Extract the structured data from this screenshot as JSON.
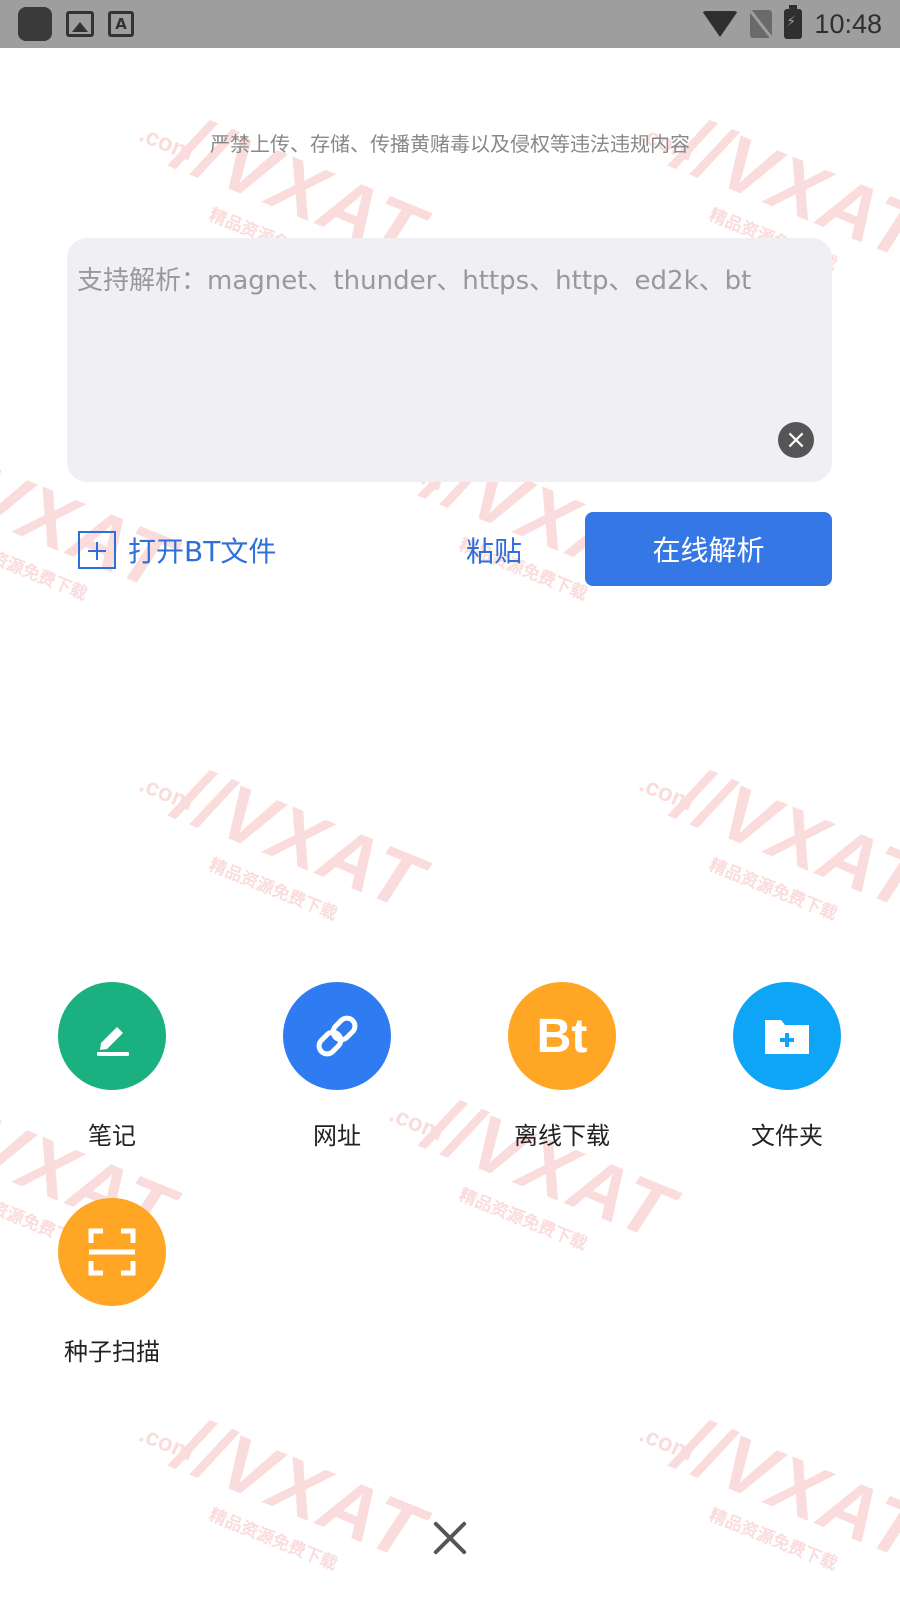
{
  "status_bar": {
    "time": "10:48"
  },
  "watermark": {
    "main": "//VXAT",
    "com": ".com",
    "sub": "精品资源免费下载"
  },
  "warning_text": "严禁上传、存储、传播黄赌毒以及侵权等违法违规内容",
  "input": {
    "placeholder": "支持解析：magnet、thunder、https、http、ed2k、bt",
    "value": ""
  },
  "actions": {
    "open_bt_label": "打开BT文件",
    "paste_label": "粘贴",
    "parse_label": "在线解析"
  },
  "tools": [
    {
      "label": "笔记",
      "icon": "pencil-icon",
      "color": "#1bb07f"
    },
    {
      "label": "网址",
      "icon": "link-icon",
      "color": "#2f7cf2"
    },
    {
      "label": "离线下载",
      "icon": "bt-icon",
      "glyph": "Bt",
      "color": "#ffa724"
    },
    {
      "label": "文件夹",
      "icon": "folder-add-icon",
      "color": "#0ea5f7"
    },
    {
      "label": "种子扫描",
      "icon": "scan-icon",
      "color": "#ffa724"
    }
  ],
  "colors": {
    "accent": "#3577e5",
    "link": "#2f6fd8"
  }
}
